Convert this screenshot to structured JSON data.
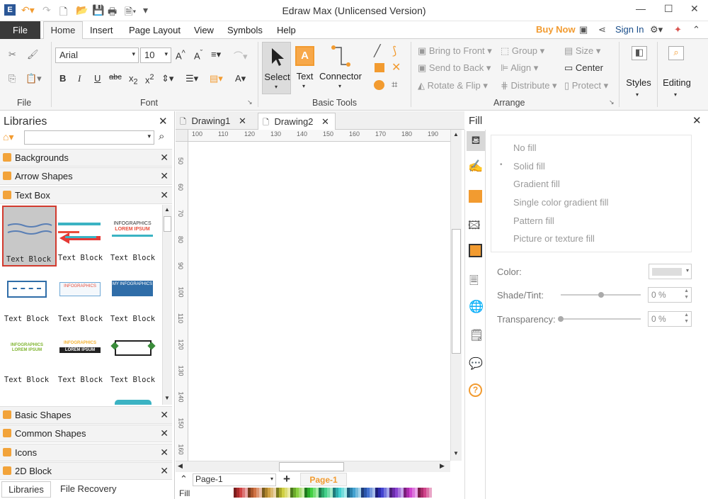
{
  "app": {
    "title": "Edraw Max (Unlicensed Version)",
    "minimize": "—",
    "maximize": "☐",
    "close": "✕"
  },
  "menu": {
    "file": "File",
    "tabs": [
      "Home",
      "Insert",
      "Page Layout",
      "View",
      "Symbols",
      "Help"
    ],
    "buy_now": "Buy Now",
    "sign_in": "Sign In"
  },
  "ribbon": {
    "font_name": "Arial",
    "font_size": "10",
    "groups": {
      "file": "File",
      "font": "Font",
      "basic_tools": "Basic Tools",
      "arrange": "Arrange"
    },
    "tools": {
      "select": "Select",
      "text": "Text",
      "connector": "Connector"
    },
    "arrange": {
      "bring_to_front": "Bring to Front",
      "send_to_back": "Send to Back",
      "rotate_flip": "Rotate & Flip",
      "group": "Group",
      "align": "Align",
      "distribute": "Distribute",
      "size": "Size",
      "center": "Center",
      "protect": "Protect"
    },
    "styles": "Styles",
    "editing": "Editing"
  },
  "libraries": {
    "title": "Libraries",
    "search_placeholder": "",
    "categories_top": [
      "Backgrounds",
      "Arrow Shapes",
      "Text Box"
    ],
    "categories_bottom": [
      "Basic Shapes",
      "Common Shapes",
      "Icons",
      "2D Block"
    ],
    "thumb_label": "Text Block",
    "bottom_tabs": [
      "Libraries",
      "File Recovery"
    ]
  },
  "documents": {
    "tabs": [
      "Drawing1",
      "Drawing2"
    ],
    "ruler_h": [
      "100",
      "110",
      "120",
      "130",
      "140",
      "150",
      "160",
      "170",
      "180",
      "190"
    ],
    "ruler_v": [
      "50",
      "60",
      "70",
      "80",
      "90",
      "100",
      "110",
      "120",
      "130",
      "140",
      "150",
      "160"
    ],
    "page_select": "Page-1",
    "page_tab": "Page-1",
    "fill_label": "Fill"
  },
  "fill_panel": {
    "title": "Fill",
    "options": [
      "No fill",
      "Solid fill",
      "Gradient fill",
      "Single color gradient fill",
      "Pattern fill",
      "Picture or texture fill"
    ],
    "color_label": "Color:",
    "shade_label": "Shade/Tint:",
    "shade_value": "0 %",
    "shade_level": 0.5,
    "transparency_label": "Transparency:",
    "transparency_value": "0 %",
    "transparency_level": 0
  },
  "colors": {
    "accent": "#f29b30",
    "selection": "#d23a2e",
    "file_tab": "#3a3a3a"
  }
}
